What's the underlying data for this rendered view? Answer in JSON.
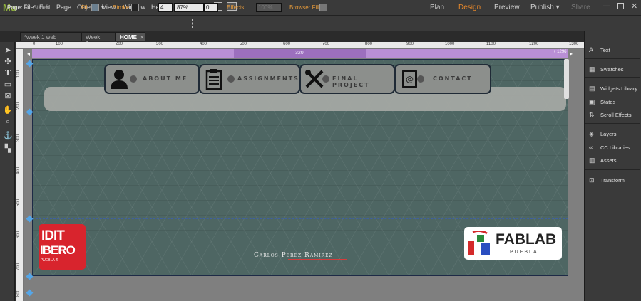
{
  "app": {
    "logo": "Mu"
  },
  "menu": [
    "File",
    "Edit",
    "Page",
    "Object",
    "View",
    "Window",
    "Help"
  ],
  "zoom": "87%",
  "topnav": {
    "plan": "Plan",
    "design": "Design",
    "preview": "Preview",
    "publish": "Publish ▾",
    "share": "Share"
  },
  "options": {
    "page_label": "Page:",
    "page_state": "No States",
    "fill_label": "Fill:",
    "stroke_label": "Stroke:",
    "stroke_value": "4",
    "rotate_value": "0",
    "effects_label": "Effects:",
    "effects_value": "100%",
    "browser_fill_label": "Browser Fill:"
  },
  "tabs": [
    {
      "label": "*week 1 web page"
    },
    {
      "label": "Week 1"
    },
    {
      "label": "HOME"
    }
  ],
  "ruler": [
    "0",
    "100",
    "200",
    "300",
    "400",
    "500",
    "600",
    "700",
    "800",
    "900",
    "1000",
    "1100",
    "1200",
    "1300"
  ],
  "vruler": [
    "100",
    "200",
    "300",
    "400",
    "500",
    "600",
    "700",
    "800"
  ],
  "breakpoint": {
    "label": "320",
    "right": "+ 1296"
  },
  "nav": [
    {
      "label": "ABOUT ME",
      "icon": "user-icon"
    },
    {
      "label": "ASSIGNMENTS",
      "icon": "clipboard-icon"
    },
    {
      "label": "FINAL PROJECT",
      "icon": "tools-icon"
    },
    {
      "label": "CONTACT",
      "icon": "contact-book-icon"
    }
  ],
  "idit": {
    "line1": "IDIT",
    "line2": "IBERO",
    "line3": "PUEBLA ®"
  },
  "fablab": {
    "name": "FABLAB",
    "sub": "PUEBLA"
  },
  "author": "Carlos Pérez Ramírez",
  "panel": [
    {
      "label": "Text",
      "icon": "text-icon"
    },
    {
      "label": "Swatches",
      "icon": "swatches-icon"
    },
    {
      "label": "Widgets Library",
      "icon": "widgets-icon"
    },
    {
      "label": "States",
      "icon": "states-icon"
    },
    {
      "label": "Scroll Effects",
      "icon": "scroll-effects-icon"
    },
    {
      "label": "Layers",
      "icon": "layers-icon"
    },
    {
      "label": "CC Libraries",
      "icon": "cc-libraries-icon"
    },
    {
      "label": "Assets",
      "icon": "assets-icon"
    },
    {
      "label": "Transform",
      "icon": "transform-icon"
    }
  ],
  "colors": {
    "accent": "#ec8a2a",
    "breakpoint": "#b98fd6",
    "page_bg": "#4e6663",
    "idit_red": "#d8242d"
  }
}
